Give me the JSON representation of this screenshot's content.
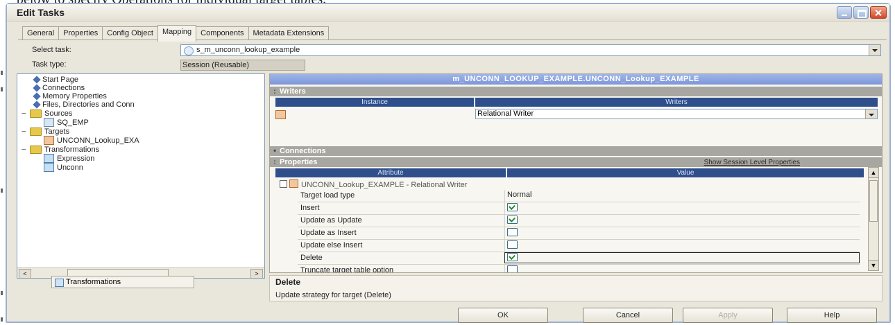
{
  "window": {
    "title": "Edit Tasks"
  },
  "tabs": [
    {
      "label": "General"
    },
    {
      "label": "Properties"
    },
    {
      "label": "Config Object"
    },
    {
      "label": "Mapping"
    },
    {
      "label": "Components"
    },
    {
      "label": "Metadata Extensions"
    }
  ],
  "form": {
    "select_task_label": "Select task:",
    "select_task_value": "s_m_unconn_lookup_example",
    "task_type_label": "Task type:",
    "task_type_value": "Session (Reusable)"
  },
  "tree": [
    {
      "label": "Start Page",
      "icon": "diamond"
    },
    {
      "label": "Connections",
      "icon": "diamond"
    },
    {
      "label": "Memory Properties",
      "icon": "diamond"
    },
    {
      "label": "Files, Directories and Conn",
      "icon": "diamond"
    },
    {
      "label": "Sources",
      "icon": "folder"
    },
    {
      "label": "SQ_EMP",
      "icon": "source-qualifier"
    },
    {
      "label": "Targets",
      "icon": "folder"
    },
    {
      "label": "UNCONN_Lookup_EXA",
      "icon": "target"
    },
    {
      "label": "Transformations",
      "icon": "folder"
    },
    {
      "label": "Expression",
      "icon": "expression"
    },
    {
      "label": "Unconn",
      "icon": "lookup"
    }
  ],
  "bottom_tab": {
    "label": "Transformations"
  },
  "panel": {
    "banner": "m_UNCONN_LOOKUP_EXAMPLE.UNCONN_Lookup_EXAMPLE",
    "writers_section": "Writers",
    "writers_headers": [
      "Instance",
      "Writers"
    ],
    "writer_value": "Relational Writer",
    "connections_section": "Connections",
    "properties_section": "Properties",
    "show_session_link": "Show Session Level Properties",
    "props_headers": [
      "Attribute",
      "Value"
    ],
    "group_label": "UNCONN_Lookup_EXAMPLE - Relational Writer",
    "properties": [
      {
        "name": "Target load type",
        "value": "Normal",
        "checked": null
      },
      {
        "name": "Insert",
        "value": "",
        "checked": true
      },
      {
        "name": "Update as Update",
        "value": "",
        "checked": true
      },
      {
        "name": "Update as Insert",
        "value": "",
        "checked": false
      },
      {
        "name": "Update else Insert",
        "value": "",
        "checked": false
      },
      {
        "name": "Delete",
        "value": "",
        "checked": true
      },
      {
        "name": "Truncate target table option",
        "value": "",
        "checked": false
      }
    ]
  },
  "description": {
    "title": "Delete",
    "text": "Update strategy for target (Delete)"
  },
  "buttons": {
    "ok": "OK",
    "cancel": "Cancel",
    "apply": "Apply",
    "help": "Help"
  },
  "partial_page_text": "below to specify Operations for individual target tables."
}
